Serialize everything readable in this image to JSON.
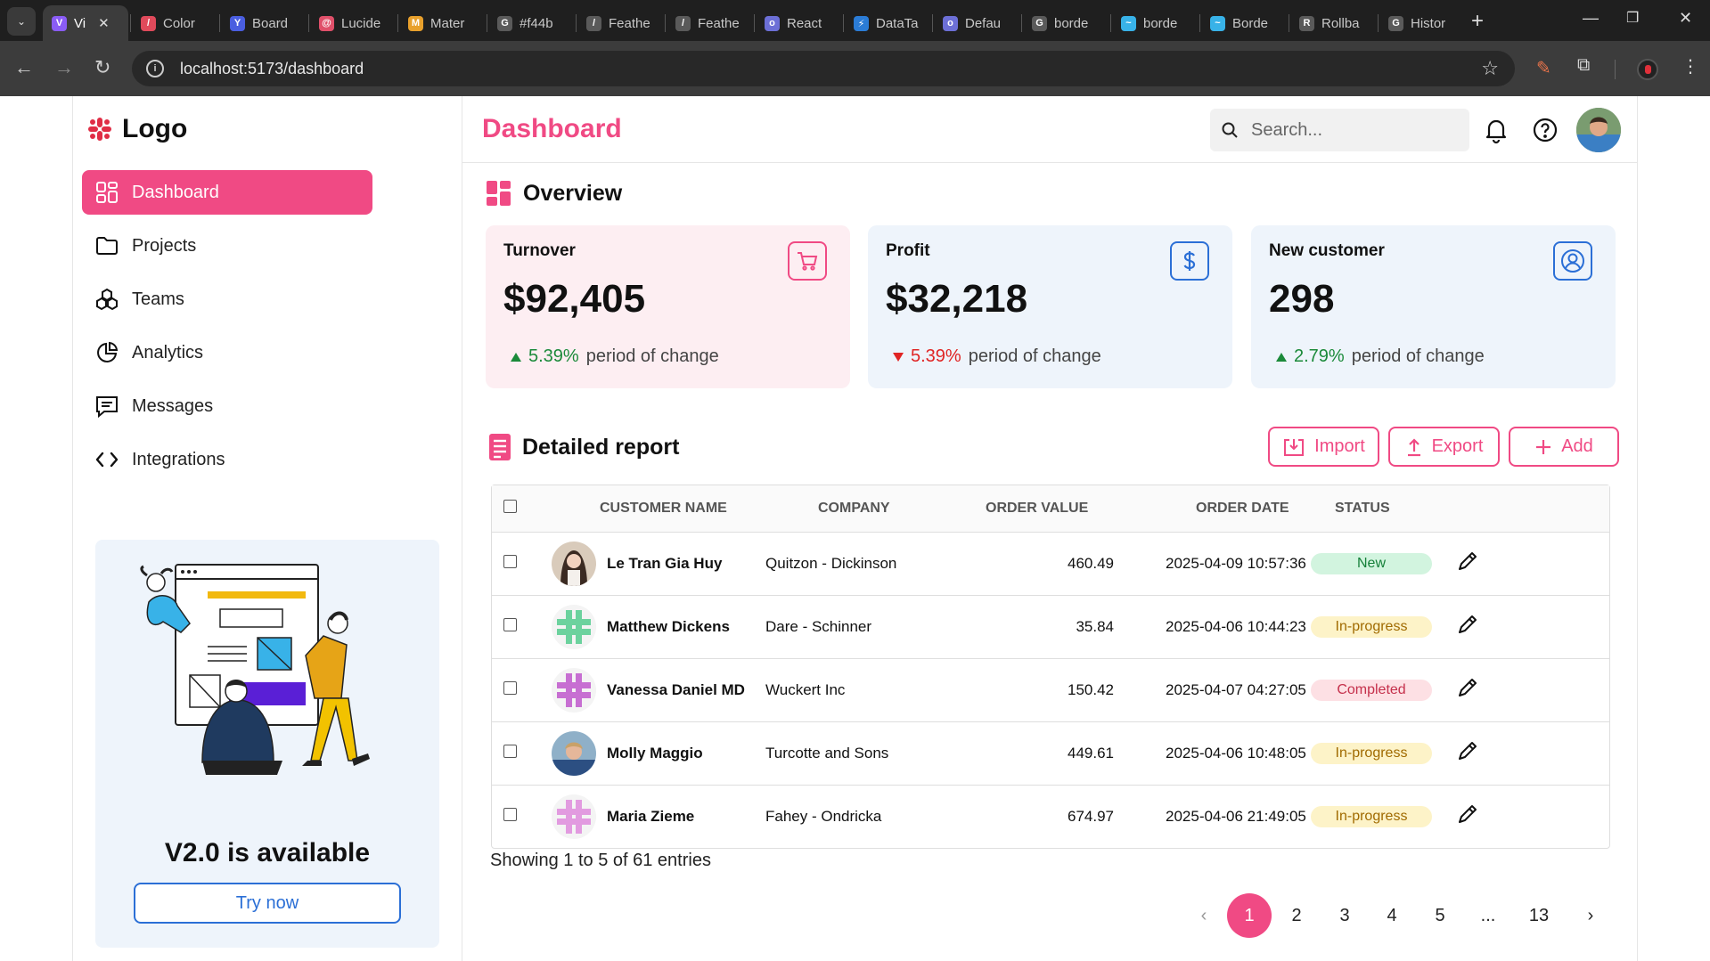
{
  "browser": {
    "tabs": [
      {
        "label": "Vi",
        "color": "#8a5cf6",
        "glyph": "V"
      },
      {
        "label": "Color",
        "color": "#e04a5b",
        "glyph": "/"
      },
      {
        "label": "Board",
        "color": "#4a5ee0",
        "glyph": "Y"
      },
      {
        "label": "Lucide",
        "color": "#e0506a",
        "glyph": "@"
      },
      {
        "label": "Mater",
        "color": "#e8a02c",
        "glyph": "M"
      },
      {
        "label": "#f44b",
        "color": "#5a5a5a",
        "glyph": "G"
      },
      {
        "label": "Feathe",
        "color": "#5a5a5a",
        "glyph": "/"
      },
      {
        "label": "Feathe",
        "color": "#5a5a5a",
        "glyph": "/"
      },
      {
        "label": "React",
        "color": "#6c6fd6",
        "glyph": "o"
      },
      {
        "label": "DataTa",
        "color": "#2b7cd6",
        "glyph": "⚡"
      },
      {
        "label": "Defau",
        "color": "#6c6fd6",
        "glyph": "o"
      },
      {
        "label": "borde",
        "color": "#5a5a5a",
        "glyph": "G"
      },
      {
        "label": "borde",
        "color": "#38b2e8",
        "glyph": "~"
      },
      {
        "label": "Borde",
        "color": "#38b2e8",
        "glyph": "~"
      },
      {
        "label": "Rollba",
        "color": "#5a5a5a",
        "glyph": "R"
      },
      {
        "label": "Histor",
        "color": "#5a5a5a",
        "glyph": "G"
      }
    ],
    "url": "localhost:5173/dashboard"
  },
  "sidebar": {
    "logo": "Logo",
    "items": [
      {
        "label": "Dashboard",
        "icon": "dashboard-icon"
      },
      {
        "label": "Projects",
        "icon": "folder-icon"
      },
      {
        "label": "Teams",
        "icon": "teams-icon"
      },
      {
        "label": "Analytics",
        "icon": "pie-chart-icon"
      },
      {
        "label": "Messages",
        "icon": "message-icon"
      },
      {
        "label": "Integrations",
        "icon": "code-icon"
      }
    ],
    "promo": {
      "title": "V2.0 is available",
      "button": "Try now"
    }
  },
  "header": {
    "title": "Dashboard",
    "search_placeholder": "Search..."
  },
  "overview": {
    "title": "Overview",
    "cards": [
      {
        "title": "Turnover",
        "value": "$92,405",
        "change": "5.39%",
        "direction": "up",
        "suffix": "period of change",
        "icon": "shopping-cart-icon",
        "bg": "#fdeef2",
        "accent": "#f04a84"
      },
      {
        "title": "Profit",
        "value": "$32,218",
        "change": "5.39%",
        "direction": "down",
        "suffix": "period of change",
        "icon": "dollar-icon",
        "bg": "#eef4fb",
        "accent": "#2b6fd6"
      },
      {
        "title": "New customer",
        "value": "298",
        "change": "2.79%",
        "direction": "up",
        "suffix": "period of change",
        "icon": "user-circle-icon",
        "bg": "#eef4fb",
        "accent": "#2b6fd6"
      }
    ]
  },
  "report": {
    "title": "Detailed report",
    "actions": {
      "import": "Import",
      "export": "Export",
      "add": "Add"
    },
    "columns": [
      "Customer name",
      "Company",
      "Order value",
      "Order date",
      "Status"
    ],
    "rows": [
      {
        "name": "Le Tran Gia Huy",
        "company": "Quitzon - Dickinson",
        "value": "460.49",
        "date": "2025-04-09 10:57:36",
        "status": "New",
        "status_class": "new",
        "avatar": "photo-woman"
      },
      {
        "name": "Matthew Dickens",
        "company": "Dare - Schinner",
        "value": "35.84",
        "date": "2025-04-06 10:44:23",
        "status": "In-progress",
        "status_class": "progress",
        "avatar": "identicon-green"
      },
      {
        "name": "Vanessa Daniel MD",
        "company": "Wuckert Inc",
        "value": "150.42",
        "date": "2025-04-07 04:27:05",
        "status": "Completed",
        "status_class": "completed",
        "avatar": "identicon-purple"
      },
      {
        "name": "Molly Maggio",
        "company": "Turcotte and Sons",
        "value": "449.61",
        "date": "2025-04-06 10:48:05",
        "status": "In-progress",
        "status_class": "progress",
        "avatar": "photo-man"
      },
      {
        "name": "Maria Zieme",
        "company": "Fahey - Ondricka",
        "value": "674.97",
        "date": "2025-04-06 21:49:05",
        "status": "In-progress",
        "status_class": "progress",
        "avatar": "identicon-pink"
      }
    ],
    "footer": "Showing 1 to 5 of 61 entries",
    "pagination": {
      "prev": "‹",
      "pages": [
        "1",
        "2",
        "3",
        "4",
        "5",
        "...",
        "13"
      ],
      "next": "›",
      "current": "1"
    }
  }
}
